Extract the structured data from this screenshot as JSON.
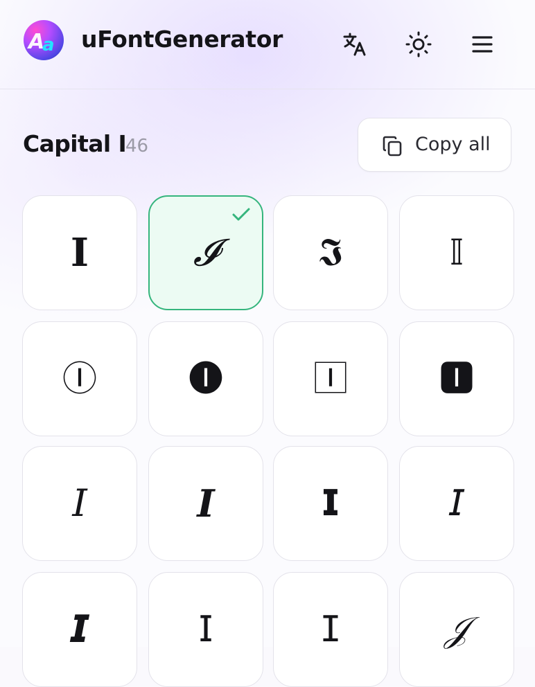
{
  "app": {
    "title": "uFontGenerator",
    "logo_text": "Aa"
  },
  "header": {
    "icons": [
      "translate-icon",
      "sun-icon",
      "menu-icon"
    ]
  },
  "section": {
    "title": "Capital I",
    "count": "46",
    "copy_all_label": "Copy all"
  },
  "colors": {
    "selected_background": "#ecfbf3",
    "selected_border": "#35b57d",
    "card_border": "#e3e2ea"
  },
  "glyphs": [
    {
      "char": "𝐈",
      "selected": false
    },
    {
      "char": "𝓘",
      "selected": true
    },
    {
      "char": "𝕴",
      "selected": false
    },
    {
      "char": "𝕀",
      "selected": false
    },
    {
      "char": "Ⓘ",
      "selected": false
    },
    {
      "char": "🅘",
      "selected": false
    },
    {
      "char": "🄸",
      "selected": false
    },
    {
      "char": "🅸",
      "selected": false
    },
    {
      "char": "𝐼",
      "selected": false
    },
    {
      "char": "𝑰",
      "selected": false
    },
    {
      "char": "𝗜",
      "selected": false
    },
    {
      "char": "𝘐",
      "selected": false
    },
    {
      "char": "𝙄",
      "selected": false
    },
    {
      "char": "𝖨",
      "selected": false
    },
    {
      "char": "𝙸",
      "selected": false
    },
    {
      "char": "𝒥",
      "selected": false
    }
  ]
}
